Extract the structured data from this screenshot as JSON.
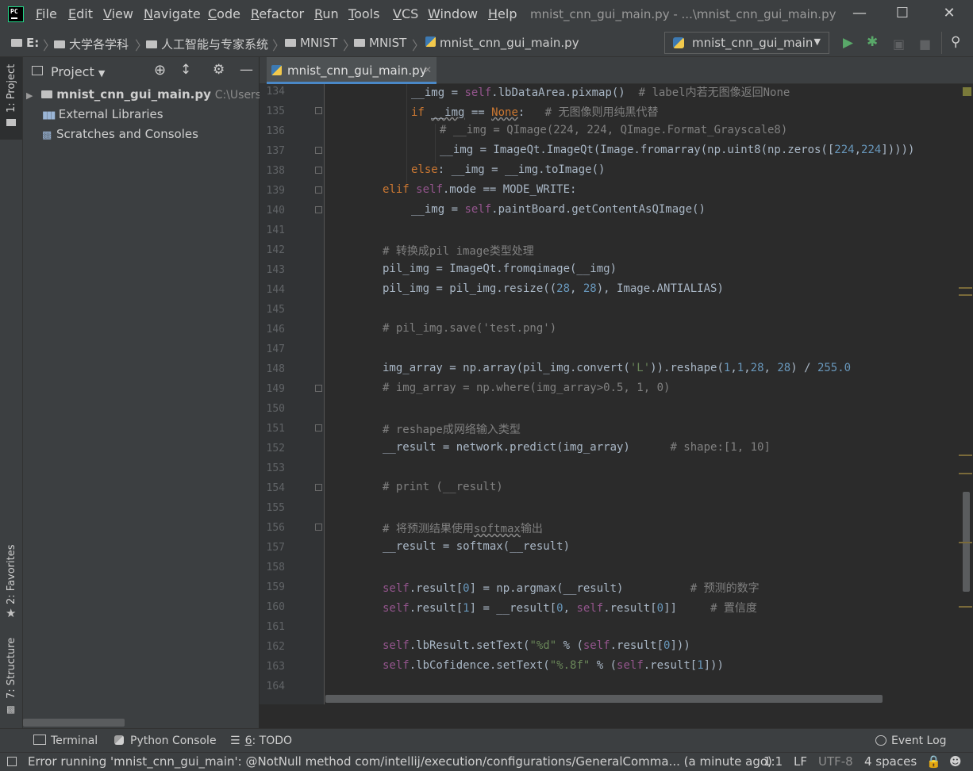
{
  "window": {
    "title": "mnist_cnn_gui_main.py - ...\\mnist_cnn_gui_main.py",
    "logo_text": "PC",
    "menu": [
      {
        "label": "File",
        "u": "F",
        "rest": "ile"
      },
      {
        "label": "Edit",
        "u": "E",
        "rest": "dit"
      },
      {
        "label": "View",
        "u": "V",
        "rest": "iew"
      },
      {
        "label": "Navigate",
        "u": "N",
        "rest": "avigate"
      },
      {
        "label": "Code",
        "u": "C",
        "rest": "ode"
      },
      {
        "label": "Refactor",
        "u": "R",
        "rest": "efactor"
      },
      {
        "label": "Run",
        "u": "R",
        "rest": "un"
      },
      {
        "label": "Tools",
        "u": "T",
        "rest": "ools"
      },
      {
        "label": "VCS",
        "u": "V",
        "rest": "CS"
      },
      {
        "label": "Window",
        "u": "W",
        "rest": "indow"
      },
      {
        "label": "Help",
        "u": "H",
        "rest": "elp"
      }
    ]
  },
  "breadcrumb": [
    "E:",
    "大学各学科",
    "人工智能与专家系统",
    "MNIST",
    "MNIST",
    "mnist_cnn_gui_main.py"
  ],
  "run_config": "mnist_cnn_gui_main",
  "left_stripe": {
    "project": "1: Project",
    "favorites": "2: Favorites",
    "structure": "7: Structure"
  },
  "project_panel": {
    "title": "Project",
    "tree": [
      {
        "label": "mnist_cnn_gui_main.py",
        "path": "C:\\Users\\"
      },
      {
        "label": "External Libraries"
      },
      {
        "label": "Scratches and Consoles"
      }
    ]
  },
  "editor": {
    "tab": "mnist_cnn_gui_main.py",
    "line_numbers": [
      "134",
      "135",
      "136",
      "137",
      "138",
      "139",
      "140",
      "141",
      "142",
      "143",
      "144",
      "145",
      "146",
      "147",
      "148",
      "149",
      "150",
      "151",
      "152",
      "153",
      "154",
      "155",
      "156",
      "157",
      "158",
      "159",
      "160",
      "161",
      "162",
      "163",
      "164"
    ]
  },
  "bottom_tools": {
    "terminal": "Terminal",
    "python_console": "Python Console",
    "todo_num": "6",
    "todo": ": TODO",
    "event_log": "Event Log"
  },
  "status": {
    "message": "Error running 'mnist_cnn_gui_main': @NotNull method com/intellij/execution/configurations/GeneralComma... (a minute ago)",
    "position": "1:1",
    "line_sep": "LF",
    "encoding": "UTF-8",
    "indent": "4 spaces"
  }
}
